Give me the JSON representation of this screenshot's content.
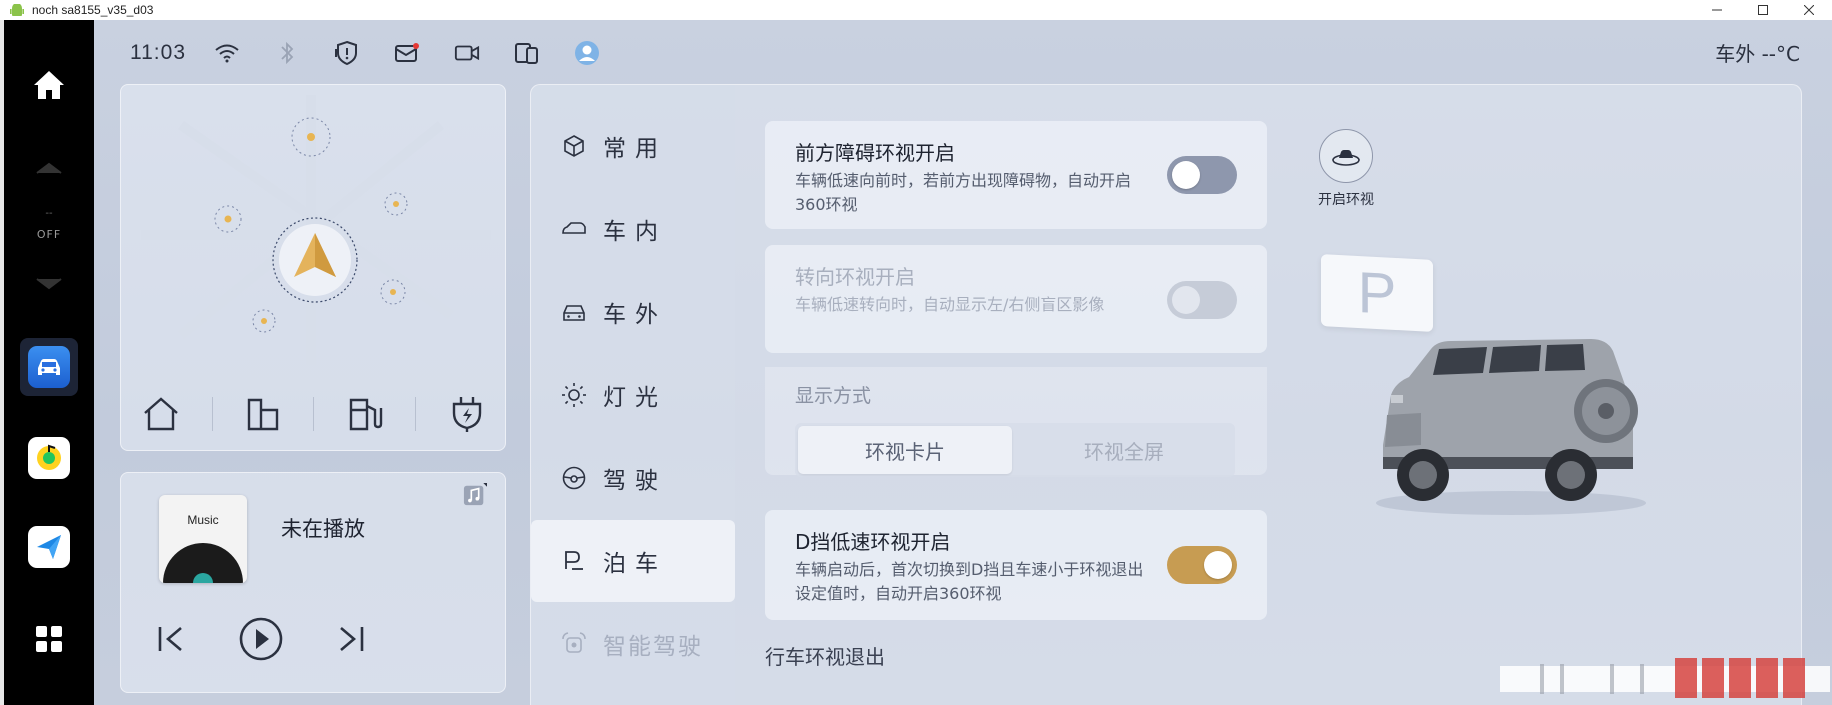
{
  "window": {
    "title": "noch sa8155_v35_d03",
    "buttons": [
      "minimize",
      "maximize",
      "close"
    ]
  },
  "dock": {
    "off_label": "OFF",
    "dash": "--",
    "apps": [
      "car-settings-app",
      "music-app",
      "navigation-app",
      "app-grid"
    ]
  },
  "status": {
    "time": "11:03",
    "outside_temp": "车外 --°C",
    "icons": [
      "wifi-icon",
      "bluetooth-icon",
      "shield-icon",
      "message-icon",
      "camera-icon",
      "phone-link-icon",
      "avatar-icon"
    ]
  },
  "music": {
    "album_label": "Music",
    "now_playing": "未在播放"
  },
  "menu": {
    "items": [
      {
        "label": "常用",
        "icon": "cube-icon"
      },
      {
        "label": "车内",
        "icon": "car-seat-icon"
      },
      {
        "label": "车外",
        "icon": "car-front-icon"
      },
      {
        "label": "灯光",
        "icon": "sun-icon"
      },
      {
        "label": "驾驶",
        "icon": "steering-wheel-icon"
      },
      {
        "label": "泊车",
        "icon": "parking-icon"
      },
      {
        "label": "智能驾驶",
        "icon": "assist-icon"
      }
    ],
    "active_index": 5
  },
  "options": {
    "front_obstacle": {
      "title": "前方障碍环视开启",
      "desc": "车辆低速向前时，若前方出现障碍物，自动开启360环视",
      "state": "off"
    },
    "turn_view": {
      "title": "转向环视开启",
      "desc": "车辆低速转向时，自动显示左/右侧盲区影像",
      "state": "disabled"
    },
    "display_mode": {
      "label": "显示方式",
      "options": [
        "环视卡片",
        "环视全屏"
      ],
      "selected": "环视卡片"
    },
    "d_gear": {
      "title": "D挡低速环视开启",
      "desc": "车辆启动后，首次切换到D挡且车速小于环视退出设定值时，自动开启360环视",
      "state": "on"
    },
    "exit_label": "行车环视退出"
  },
  "right": {
    "open_view_label": "开启环视",
    "parking_sign": "P"
  },
  "colors": {
    "toggle_on": "#c79c52",
    "toggle_off": "#8e97ad",
    "background": "#c6cedd"
  }
}
